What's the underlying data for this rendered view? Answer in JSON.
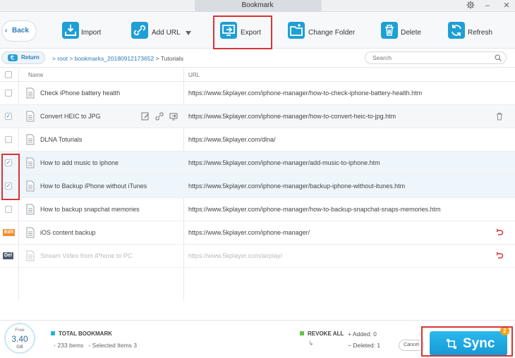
{
  "window": {
    "title": "Bookmark"
  },
  "toolbar": {
    "back_label": "Back",
    "import_label": "Import",
    "add_url_label": "Add URL",
    "export_label": "Export",
    "change_folder_label": "Change Folder",
    "delete_label": "Delete",
    "refresh_label": "Refresh"
  },
  "pathbar": {
    "return_label": "Return",
    "crumb_root": "root",
    "crumb_folder": "bookmarks_20180912173652",
    "crumb_current": "Tutorials",
    "search_placeholder": "Search"
  },
  "table": {
    "header_name": "Name",
    "header_url": "URL",
    "rows": [
      {
        "name": "Check iPhone battery health",
        "url": "https://www.5kplayer.com/iphone-manager/how-to-check-iphone-battery-health.htm",
        "checked": false
      },
      {
        "name": "Convert HEIC to JPG",
        "url": "https://www.5kplayer.com/iphone-manager/how-to-convert-heic-to-jpg.htm",
        "checked": true
      },
      {
        "name": "DLNA Toturials",
        "url": "https://www.5kplayer.com/dlna/",
        "checked": false
      },
      {
        "name": "How to add music to iphone",
        "url": "https://www.5kplayer.com/iphone-manager/add-music-to-iphone.htm",
        "checked": true
      },
      {
        "name": "How to Backup iPhone without iTunes",
        "url": "https://www.5kplayer.com/iphone-manager/backup-iphone-without-itunes.htm",
        "checked": true
      },
      {
        "name": "How to backup snapchat memories",
        "url": "https://www.5kplayer.com/iphone-manager/how-to-backup-snapchat-snaps-memories.htm",
        "checked": false
      },
      {
        "name": "iOS content backup",
        "url": "https://www.5kplayer.com/iphone-manager/",
        "tag": "Edit"
      },
      {
        "name": "Stream Video from iPhone to PC",
        "url": "https://www.5kplayer.com/airplay/",
        "tag": "Del"
      }
    ]
  },
  "footer": {
    "storage_label": "Free",
    "storage_value": "3.40",
    "storage_unit": "GB",
    "total_label": "TOTAL BOOKMARK",
    "items_text": "233 items",
    "selected_text": "Selected Items 3",
    "revoke_label": "REVOKE ALL",
    "added_text": "Added: 0",
    "deleted_text": "Deleted: 1",
    "cancel_label": "Cancel",
    "sync_label": "Sync",
    "sync_badge": "2"
  },
  "colors": {
    "accent": "#1e9fd6",
    "highlight": "#d63535",
    "edit_tag": "#f08c2c",
    "del_tag": "#4e5b6e",
    "revert": "#d63535"
  }
}
